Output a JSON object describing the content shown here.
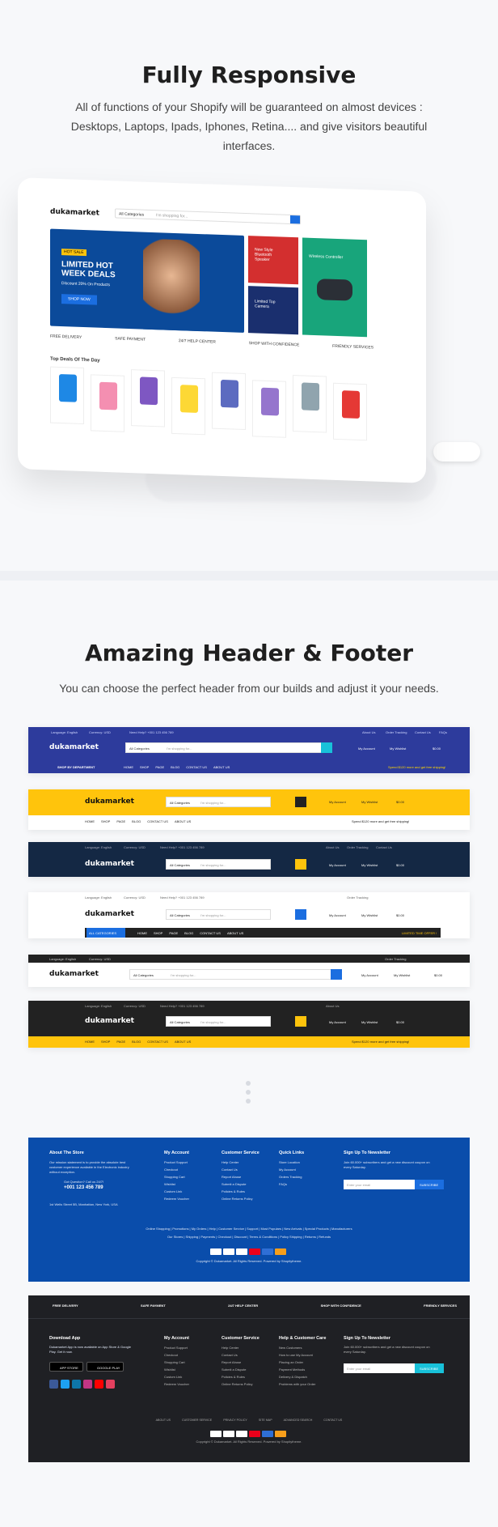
{
  "section1": {
    "title": "Fully Responsive",
    "subtitle": "All of functions of your Shopify will be guaranteed on almost devices : Desktops, Laptops, Ipads, Iphones, Retina.... and give visitors beautiful interfaces."
  },
  "laptop": {
    "logo": "dukamarket",
    "search_placeholder": "I'm shopping for...",
    "category": "All Categories",
    "hero_badge": "HOT SALE",
    "hero_title": "LIMITED HOT WEEK DEALS",
    "hero_sub": "Discount 20% On Products",
    "hero_btn": "SHOP NOW",
    "promo1": "New Style Bluetooth Speaker",
    "promo2": "Limited Top Camera",
    "promo3": "Wireless Controller",
    "deals_title": "Top Deals Of The Day",
    "features": [
      "FREE DELIVERY",
      "SAFE PAYMENT",
      "24/7 HELP CENTER",
      "SHOP WITH CONFIDENCE",
      "FRIENDLY SERVICES"
    ]
  },
  "section2": {
    "title": "Amazing Header & Footer",
    "subtitle": "You can choose the perfect header from our builds and adjust it your needs."
  },
  "headers": {
    "logo": "dukamarket",
    "category": "All Categories",
    "search": "I'm shopping for...",
    "language": "Language: English",
    "currency": "Currency: USD",
    "help": "Need Help? +001 123 456 789",
    "about": "About Us",
    "tracking": "Order Tracking",
    "contact": "Contact Us",
    "faqs": "FAQs",
    "account": "My Account",
    "wishlist": "My Wishlist",
    "cart": "$0.00",
    "department": "SHOP BY DEPARTMENT",
    "all_categories": "ALL CATEGORIES",
    "nav": [
      "HOME",
      "SHOP",
      "PAGE",
      "BLOG",
      "CONTACT US",
      "ABOUT US"
    ],
    "free_ship": "Spend $120 more and get free shipping!",
    "limited": "LIMITED TIME OFFER !"
  },
  "footer1": {
    "about_title": "About The Store",
    "about_text": "Our mission statement is to provide the absolute best customer experience available in the Electronic industry without exception.",
    "phone_label": "Got Question? Call us 24/7!",
    "phone": "+001 123 456 789",
    "address": "1st Wells Street 5B, Manhattan, New York, USA",
    "account_title": "My Account",
    "account_items": [
      "Product Support",
      "Checkout",
      "Shopping Cart",
      "Wishlist",
      "Custom Link",
      "Redeem Voucher"
    ],
    "service_title": "Customer Service",
    "service_items": [
      "Help Center",
      "Contact Us",
      "Report Abuse",
      "Submit a Dispute",
      "Policies & Rules",
      "Online Returns Policy"
    ],
    "links_title": "Quick Links",
    "links_items": [
      "Store Location",
      "My Account",
      "Orders Tracking",
      "FAQs"
    ],
    "news_title": "Sign Up To Newsletter",
    "news_text": "Join 60.000+ subscribers and get a new discount coupon on every Saturday.",
    "email_placeholder": "Enter your email",
    "subscribe": "SUBSCRIBE",
    "links_row1": "Online Shopping | Promotions | My Orders | Help | Customer Service | Support | Most Populars | New Arrivals | Special Products | Manufacturers",
    "links_row2": "Our Stores | Shipping | Payments | Checkout | Discount | Terms & Conditions | Policy Shipping | Returns | Refunds",
    "copyright": "Copyright © Dukamarket. All Rights Reserved. Powered by Shopitytheme."
  },
  "footer2": {
    "features": [
      "FREE DELIVERY",
      "SAFE PAYMENT",
      "24/7 HELP CENTER",
      "SHOP WITH CONFIDENCE",
      "FRIENDLY SERVICES"
    ],
    "app_title": "Download App",
    "app_text": "Dukamarket App is now available on App Store & Google Play. Get it now.",
    "app_store": "APP STORE",
    "google_play": "GOOGLE PLAY",
    "account_title": "My Account",
    "service_title": "Customer Service",
    "care_title": "Help & Customer Care",
    "care_items": [
      "New Customers",
      "How to use My Account",
      "Placing an Order",
      "Payment Methods",
      "Delivery & Dispatch",
      "Problems with your Order"
    ],
    "news_title": "Sign Up To Newsletter",
    "bottom_links": [
      "ABOUT US",
      "CUSTOMER SERVICE",
      "PRIVACY POLICY",
      "SITE MAP",
      "ADVANCED SEARCH",
      "CONTACT US"
    ],
    "copyright": "Copyright © Dukamarket. All Rights Reserved. Powered by Shopitytheme."
  },
  "colors": {
    "blue": "#2d3b9c",
    "yellow": "#ffc40c",
    "navy": "#142844",
    "dark": "#222",
    "footer_blue": "#0a4dab",
    "footer_dark": "#1f2024"
  }
}
